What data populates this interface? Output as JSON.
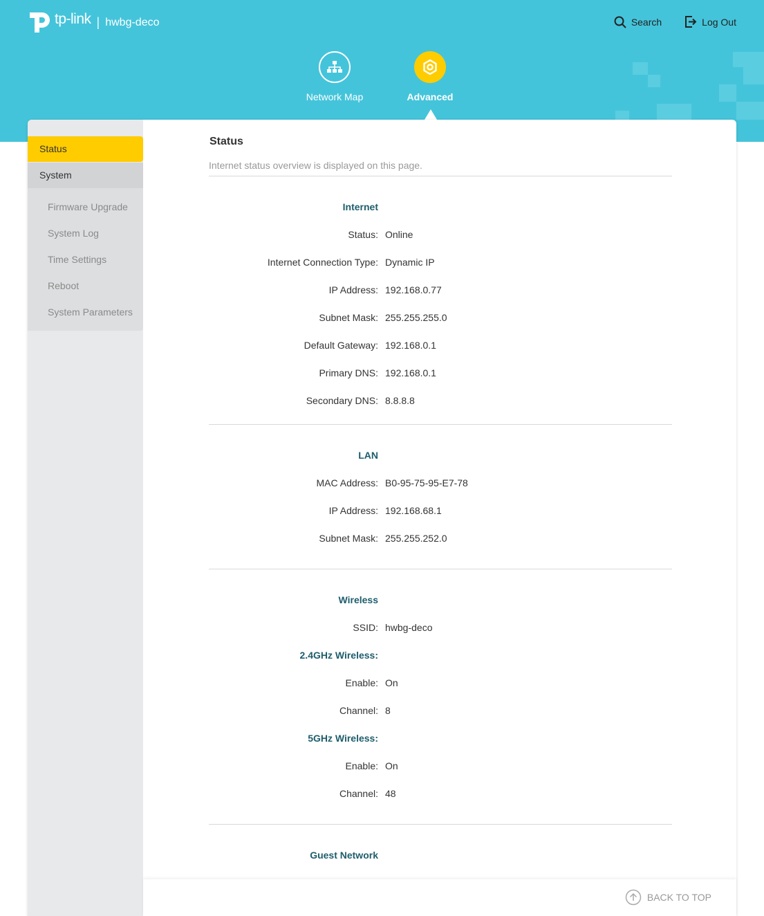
{
  "brand": {
    "logo_text": "tp-link",
    "separator": "|",
    "device_name": "hwbg-deco"
  },
  "top_actions": {
    "search_label": "Search",
    "logout_label": "Log Out"
  },
  "nav_tabs": {
    "network_map": "Network Map",
    "advanced": "Advanced"
  },
  "sidebar": {
    "status": "Status",
    "system": "System",
    "sub": [
      "Firmware Upgrade",
      "System Log",
      "Time Settings",
      "Reboot",
      "System Parameters"
    ]
  },
  "page": {
    "title": "Status",
    "description": "Internet status overview is displayed on this page."
  },
  "internet": {
    "title": "Internet",
    "status_label": "Status:",
    "status_value": "Online",
    "conn_type_label": "Internet Connection Type:",
    "conn_type_value": "Dynamic IP",
    "ip_label": "IP Address:",
    "ip_value": "192.168.0.77",
    "mask_label": "Subnet Mask:",
    "mask_value": "255.255.255.0",
    "gateway_label": "Default Gateway:",
    "gateway_value": "192.168.0.1",
    "dns1_label": "Primary DNS:",
    "dns1_value": "192.168.0.1",
    "dns2_label": "Secondary DNS:",
    "dns2_value": "8.8.8.8"
  },
  "lan": {
    "title": "LAN",
    "mac_label": "MAC Address:",
    "mac_value": "B0-95-75-95-E7-78",
    "ip_label": "IP Address:",
    "ip_value": "192.168.68.1",
    "mask_label": "Subnet Mask:",
    "mask_value": "255.255.252.0"
  },
  "wireless": {
    "title": "Wireless",
    "ssid_label": "SSID:",
    "ssid_value": "hwbg-deco",
    "band24_title": "2.4GHz Wireless:",
    "band24_enable_label": "Enable:",
    "band24_enable_value": "On",
    "band24_channel_label": "Channel:",
    "band24_channel_value": "8",
    "band5_title": "5GHz Wireless:",
    "band5_enable_label": "Enable:",
    "band5_enable_value": "On",
    "band5_channel_label": "Channel:",
    "band5_channel_value": "48"
  },
  "guest": {
    "title": "Guest Network"
  },
  "footer": {
    "back_to_top": "BACK TO TOP"
  },
  "colors": {
    "header": "#44c4da",
    "accent": "#ffcc00",
    "section_title": "#1e5d6b"
  }
}
